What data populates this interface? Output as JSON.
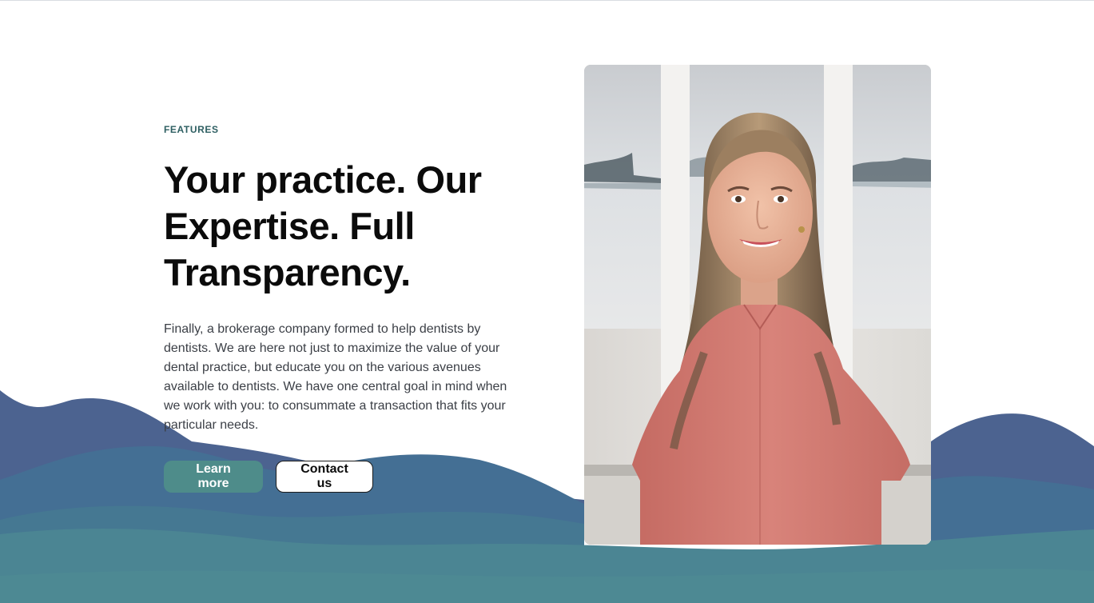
{
  "hero": {
    "eyebrow": "FEATURES",
    "headline": "Your practice. Our Expertise. Full Transparency.",
    "body": "Finally, a brokerage company formed to help dentists by dentists. We are here not just to maximize the value of your dental practice, but educate you on the various avenues available to dentists. We have one central goal in mind when we work with you: to consummate a transaction that fits your particular needs.",
    "primary_button": "Learn more",
    "secondary_button": "Contact us"
  },
  "photo": {
    "alt": "Portrait of a smiling woman in a coral blouse"
  },
  "colors": {
    "accent": "#4e8c8a",
    "eyebrow": "#2e5f62",
    "wave_dark": "#4c6390",
    "wave_mid": "#446f94",
    "wave_teal": "#4b8593"
  }
}
